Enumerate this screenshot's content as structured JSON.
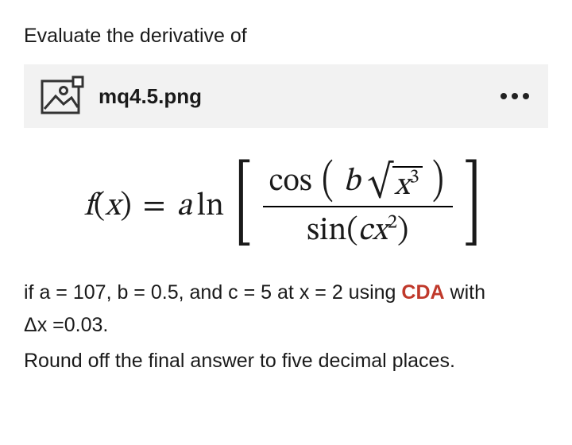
{
  "prompt": "Evaluate the derivative of",
  "attachment": {
    "filename": "mq4.5.png",
    "icon": "image-placeholder-icon",
    "more": "more-options"
  },
  "formula": {
    "lhs_f": "f",
    "lhs_open": "(",
    "lhs_x": "x",
    "lhs_close": ")",
    "eq": "=",
    "a": "a",
    "ln": "ln",
    "num_cos": "cos",
    "num_b": "b",
    "num_x": "x",
    "num_exp": "3",
    "den_sin": "sin",
    "den_open": "(",
    "den_c": "c",
    "den_x": "x",
    "den_exp": "2",
    "den_close": ")"
  },
  "conditions": {
    "line1_pre": "if a = ",
    "a": "107",
    "sep1": ", b = ",
    "b": "0.5",
    "sep2": ", and c = ",
    "c": "5",
    "sep3": " at x = ",
    "x": "2",
    "sep4": " using ",
    "method": "CDA",
    "sep5": "  with",
    "line2_pre": "Δx =",
    "dx": "0.03",
    "line2_post": "."
  },
  "round": "Round off the final answer to five decimal places.",
  "chart_data": {
    "type": "table",
    "title": "Numerical derivative problem parameters",
    "parameters": {
      "a": 107,
      "b": 0.5,
      "c": 5,
      "x": 2,
      "delta_x": 0.03
    },
    "function": "f(x) = a * ln( cos(b * sqrt(x^3)) / sin(c * x^2) )",
    "method": "CDA (Central Difference Approximation)",
    "round_to_decimal_places": 5
  }
}
